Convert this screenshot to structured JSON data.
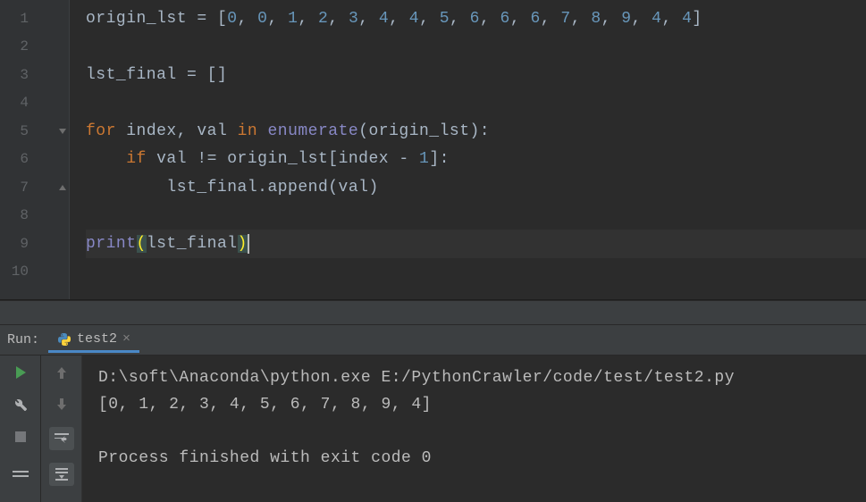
{
  "editor": {
    "lines": [
      {
        "n": 1,
        "tokens": [
          {
            "t": "origin_lst ",
            "c": "tk-var"
          },
          {
            "t": "= ",
            "c": "tk-op"
          },
          {
            "t": "[",
            "c": "tk-punct"
          },
          {
            "t": "0",
            "c": "tk-num"
          },
          {
            "t": ", ",
            "c": "tk-punct"
          },
          {
            "t": "0",
            "c": "tk-num"
          },
          {
            "t": ", ",
            "c": "tk-punct"
          },
          {
            "t": "1",
            "c": "tk-num"
          },
          {
            "t": ", ",
            "c": "tk-punct"
          },
          {
            "t": "2",
            "c": "tk-num"
          },
          {
            "t": ", ",
            "c": "tk-punct"
          },
          {
            "t": "3",
            "c": "tk-num"
          },
          {
            "t": ", ",
            "c": "tk-punct"
          },
          {
            "t": "4",
            "c": "tk-num"
          },
          {
            "t": ", ",
            "c": "tk-punct"
          },
          {
            "t": "4",
            "c": "tk-num"
          },
          {
            "t": ", ",
            "c": "tk-punct"
          },
          {
            "t": "5",
            "c": "tk-num"
          },
          {
            "t": ", ",
            "c": "tk-punct"
          },
          {
            "t": "6",
            "c": "tk-num"
          },
          {
            "t": ", ",
            "c": "tk-punct"
          },
          {
            "t": "6",
            "c": "tk-num"
          },
          {
            "t": ", ",
            "c": "tk-punct"
          },
          {
            "t": "6",
            "c": "tk-num"
          },
          {
            "t": ", ",
            "c": "tk-punct"
          },
          {
            "t": "7",
            "c": "tk-num"
          },
          {
            "t": ", ",
            "c": "tk-punct"
          },
          {
            "t": "8",
            "c": "tk-num"
          },
          {
            "t": ", ",
            "c": "tk-punct"
          },
          {
            "t": "9",
            "c": "tk-num"
          },
          {
            "t": ", ",
            "c": "tk-punct"
          },
          {
            "t": "4",
            "c": "tk-num"
          },
          {
            "t": ", ",
            "c": "tk-punct"
          },
          {
            "t": "4",
            "c": "tk-num"
          },
          {
            "t": "]",
            "c": "tk-punct"
          }
        ]
      },
      {
        "n": 2,
        "tokens": []
      },
      {
        "n": 3,
        "tokens": [
          {
            "t": "lst_final ",
            "c": "tk-var"
          },
          {
            "t": "= ",
            "c": "tk-op"
          },
          {
            "t": "[]",
            "c": "tk-punct"
          }
        ]
      },
      {
        "n": 4,
        "tokens": []
      },
      {
        "n": 5,
        "fold": "open",
        "tokens": [
          {
            "t": "for ",
            "c": "tk-keyword"
          },
          {
            "t": "index",
            "c": "tk-var"
          },
          {
            "t": ", ",
            "c": "tk-punct"
          },
          {
            "t": "val ",
            "c": "tk-var"
          },
          {
            "t": "in ",
            "c": "tk-keyword"
          },
          {
            "t": "enumerate",
            "c": "tk-builtin"
          },
          {
            "t": "(origin_lst):",
            "c": "tk-punct"
          }
        ]
      },
      {
        "n": 6,
        "tokens": [
          {
            "t": "    ",
            "c": ""
          },
          {
            "t": "if ",
            "c": "tk-keyword"
          },
          {
            "t": "val ",
            "c": "tk-var"
          },
          {
            "t": "!= ",
            "c": "tk-op"
          },
          {
            "t": "origin_lst[index ",
            "c": "tk-var"
          },
          {
            "t": "- ",
            "c": "tk-op"
          },
          {
            "t": "1",
            "c": "tk-num"
          },
          {
            "t": "]:",
            "c": "tk-punct"
          }
        ]
      },
      {
        "n": 7,
        "fold": "close",
        "tokens": [
          {
            "t": "        ",
            "c": ""
          },
          {
            "t": "lst_final.append(val)",
            "c": "tk-var"
          }
        ]
      },
      {
        "n": 8,
        "tokens": []
      },
      {
        "n": 9,
        "current": true,
        "tokens": [
          {
            "t": "print",
            "c": "tk-builtin"
          },
          {
            "t": "(",
            "c": "tk-bracket-hl"
          },
          {
            "t": "lst_final",
            "c": "tk-var"
          },
          {
            "t": ")",
            "c": "tk-bracket-hl"
          }
        ]
      },
      {
        "n": 10,
        "tokens": []
      }
    ]
  },
  "run": {
    "label": "Run:",
    "tab_name": "test2",
    "console": [
      "D:\\soft\\Anaconda\\python.exe E:/PythonCrawler/code/test/test2.py",
      "[0, 1, 2, 3, 4, 5, 6, 7, 8, 9, 4]",
      "",
      "Process finished with exit code 0"
    ]
  }
}
